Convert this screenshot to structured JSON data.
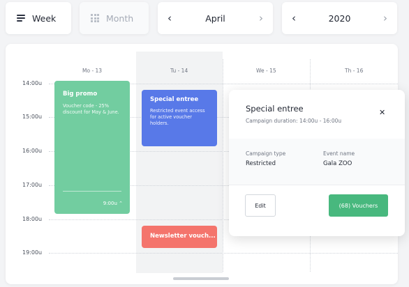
{
  "controls": {
    "week_label": "Week",
    "month_label": "Month",
    "month_nav": {
      "prev": "‹",
      "title": "April",
      "next": "›"
    },
    "year_nav": {
      "prev": "‹",
      "title": "2020",
      "next": "›"
    }
  },
  "calendar": {
    "days": [
      "Mo - 13",
      "Tu - 14",
      "We - 15",
      "Th - 16"
    ],
    "times": [
      "14:00u",
      "15:00u",
      "16:00u",
      "17:00u",
      "18:00u",
      "19:00u"
    ],
    "events": {
      "promo": {
        "title": "Big promo",
        "description": "Voucher code - 25% discount for May & June.",
        "time": "9:00u",
        "chevron": "⌃",
        "color": "#72cda0"
      },
      "special": {
        "title": "Special entree",
        "description": "Restricted event access for active voucher holders.",
        "color": "#5879e8"
      },
      "newsletter": {
        "title": "Newsletter vouch...",
        "color": "#f4746c"
      }
    }
  },
  "popover": {
    "title": "Special entree",
    "subtitle": "Campaign duration: 14:00u - 16:00u",
    "close": "✕",
    "campaign_type_label": "Campaign type",
    "campaign_type_value": "Restricted",
    "event_name_label": "Event name",
    "event_name_value": "Gala ZOO",
    "edit_label": "Edit",
    "vouchers_label": "(68) Vouchers",
    "vouchers_color": "#48b87e"
  }
}
